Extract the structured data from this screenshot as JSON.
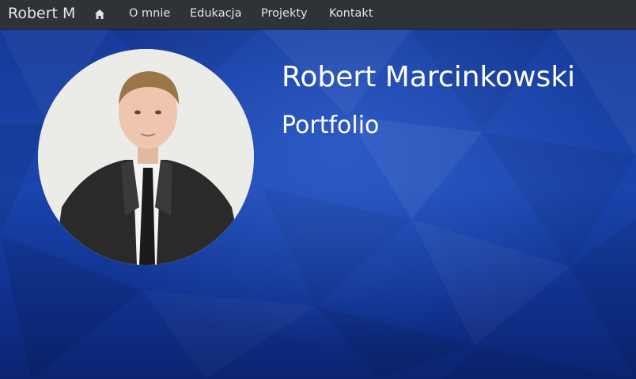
{
  "navbar": {
    "brand": "Robert M",
    "home_icon": "home-icon",
    "links": [
      "O mnie",
      "Edukacja",
      "Projekty",
      "Kontakt"
    ]
  },
  "hero": {
    "title": "Robert Marcinkowski",
    "subtitle": "Portfolio",
    "avatar_alt": "portrait photo"
  },
  "colors": {
    "navbar_bg": "#2f3236",
    "hero_blue": "#1a45ad",
    "text": "#ffffff"
  }
}
